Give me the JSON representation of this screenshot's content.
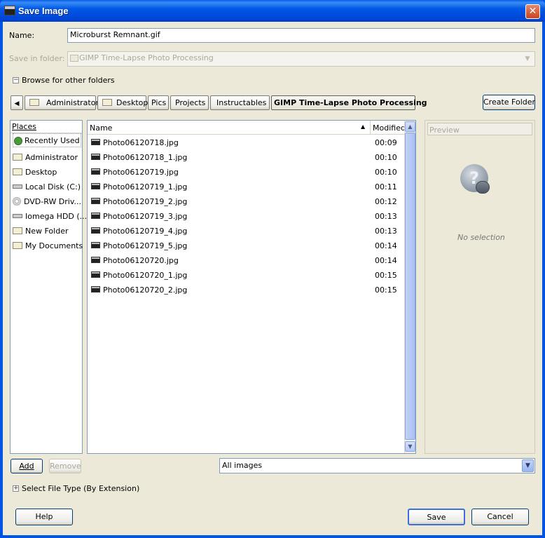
{
  "window": {
    "title": "Save Image",
    "close_glyph": "✕"
  },
  "name_field": {
    "label": "Name:",
    "value": "Microburst Remnant.gif"
  },
  "save_in_folder": {
    "label": "Save in folder:",
    "value": "GIMP Time-Lapse Photo Processing"
  },
  "browse_toggle": {
    "label": "Browse for other folders",
    "glyph": "−"
  },
  "breadcrumbs": [
    "Administrator",
    "Desktop",
    "Pics",
    "Projects",
    "Instructables",
    "GIMP Time-Lapse Photo Processing"
  ],
  "create_folder_label": "Create Folder",
  "places": {
    "header": "Places",
    "items": [
      "Recently Used",
      "Administrator",
      "Desktop",
      "Local Disk (C:)",
      "DVD-RW Driv...",
      "Iomega HDD (...",
      "New Folder",
      "My Documents"
    ]
  },
  "file_list": {
    "col_name": "Name",
    "col_modified": "Modified",
    "sort_glyph": "▲",
    "rows": [
      {
        "name": "Photo06120718.jpg",
        "modified": "00:09"
      },
      {
        "name": "Photo06120718_1.jpg",
        "modified": "00:10"
      },
      {
        "name": "Photo06120719.jpg",
        "modified": "00:10"
      },
      {
        "name": "Photo06120719_1.jpg",
        "modified": "00:11"
      },
      {
        "name": "Photo06120719_2.jpg",
        "modified": "00:12"
      },
      {
        "name": "Photo06120719_3.jpg",
        "modified": "00:13"
      },
      {
        "name": "Photo06120719_4.jpg",
        "modified": "00:13"
      },
      {
        "name": "Photo06120719_5.jpg",
        "modified": "00:14"
      },
      {
        "name": "Photo06120720.jpg",
        "modified": "00:14"
      },
      {
        "name": "Photo06120720_1.jpg",
        "modified": "00:15"
      },
      {
        "name": "Photo06120720_2.jpg",
        "modified": "00:15"
      }
    ]
  },
  "preview": {
    "label": "Preview",
    "no_selection": "No selection",
    "question_glyph": "?"
  },
  "add_label": "Add",
  "remove_label": "Remove",
  "filter": {
    "value": "All images",
    "arrow": "▼"
  },
  "file_type_toggle": {
    "label": "Select File Type (By Extension)",
    "glyph": "+"
  },
  "help_label": "Help",
  "save_label": "Save",
  "cancel_label": "Cancel",
  "colors": {
    "title_bar": "#0054e3",
    "dialog_bg": "#ece9d8",
    "entry_border": "#7f9db9"
  }
}
